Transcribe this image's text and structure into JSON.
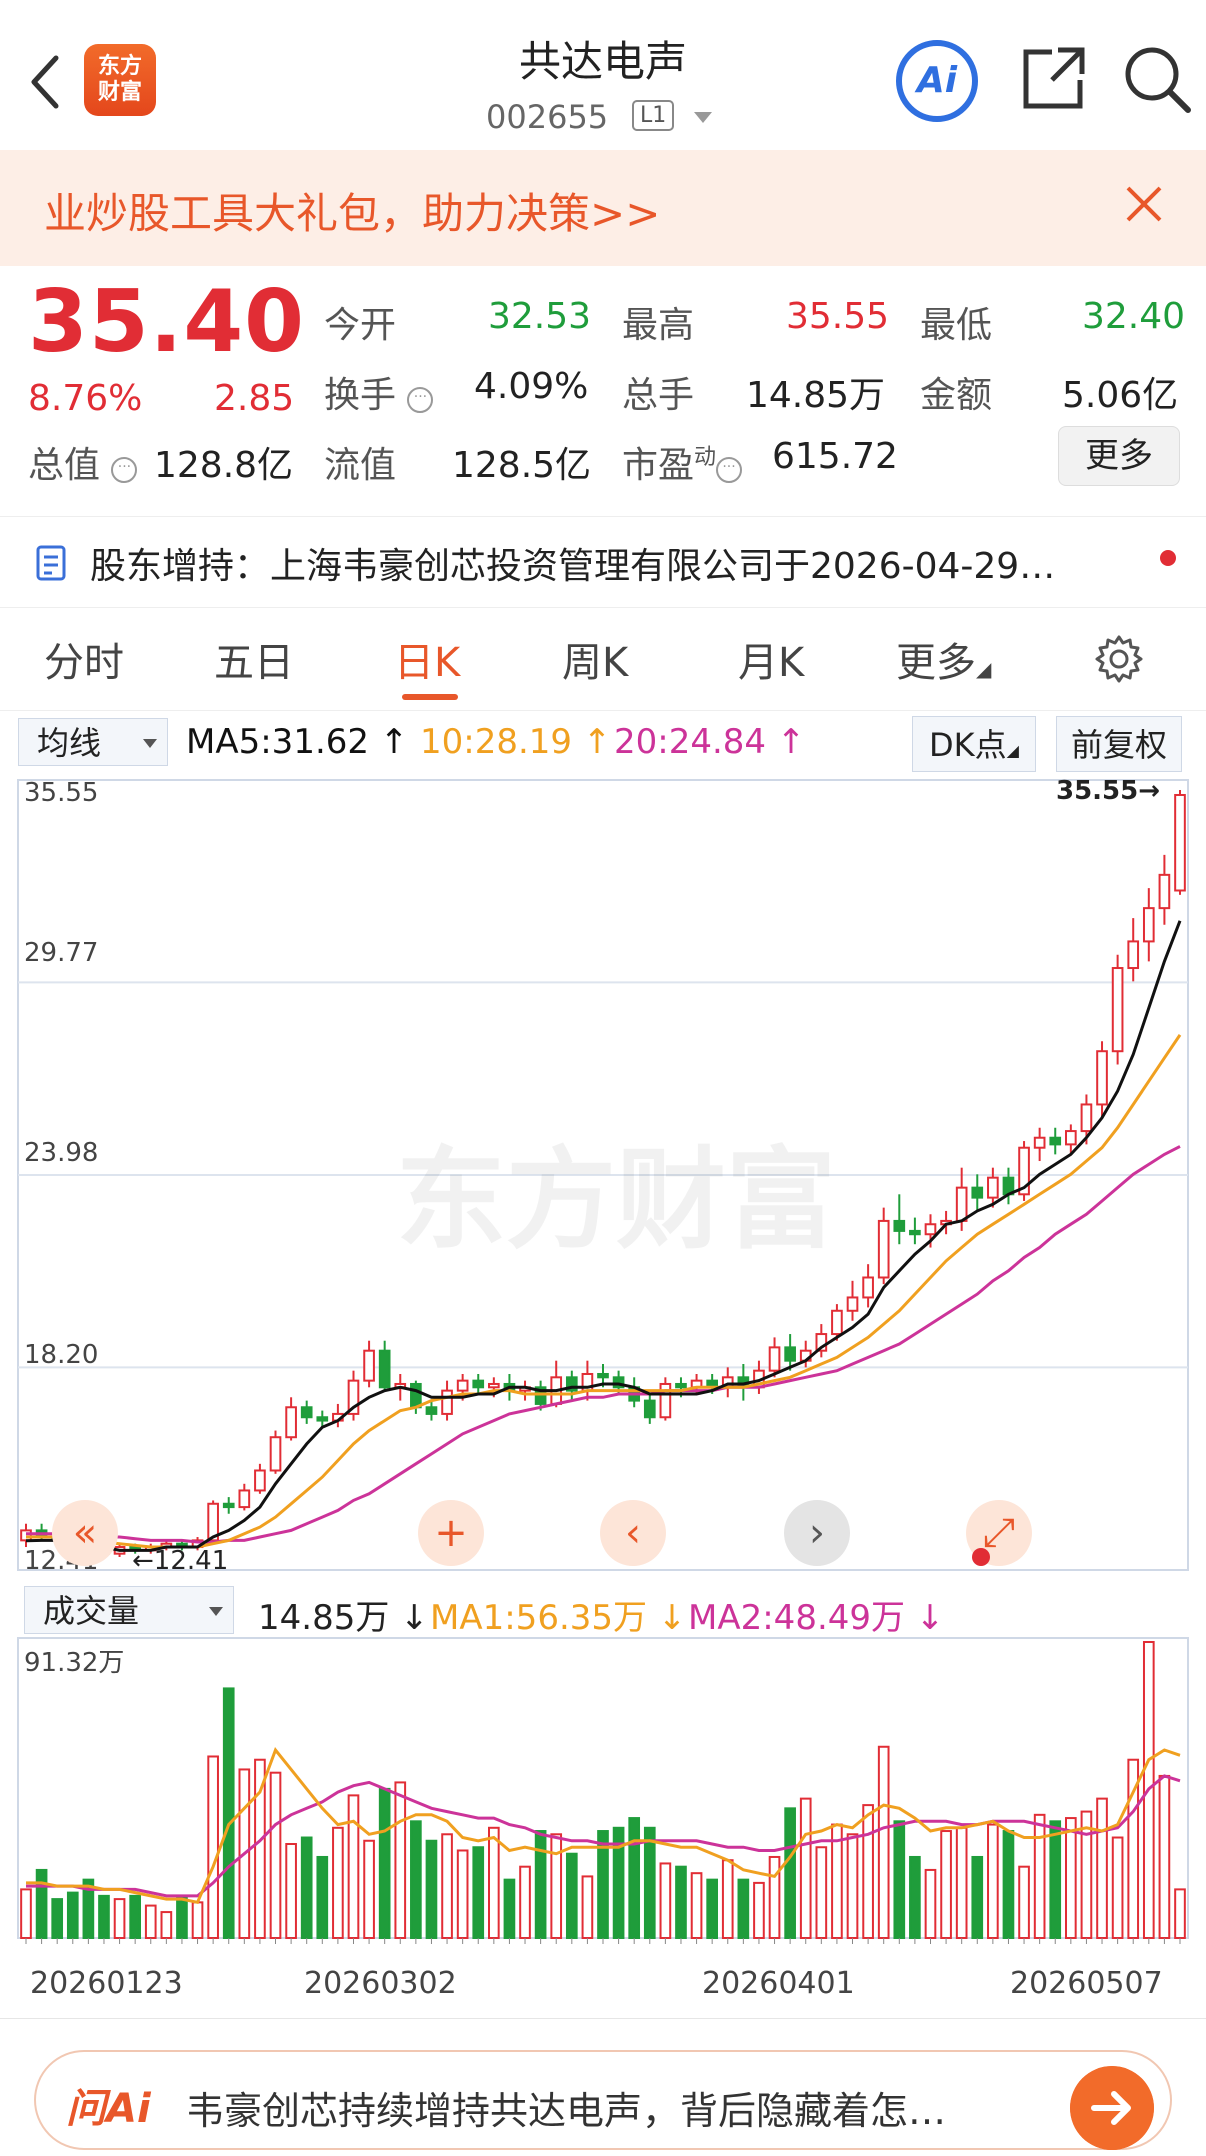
{
  "header": {
    "stock_name": "共达电声",
    "stock_code": "002655",
    "level": "L1",
    "logo_text_1": "东方",
    "logo_text_2": "财富",
    "ai_label": "Ai"
  },
  "banner": {
    "text": "业炒股工具大礼包，助力决策>>"
  },
  "quote": {
    "price": "35.40",
    "change_pct": "8.76%",
    "change": "2.85",
    "open_label": "今开",
    "open": "32.53",
    "high_label": "最高",
    "high": "35.55",
    "low_label": "最低",
    "low": "32.40",
    "turnover_label": "换手",
    "turnover": "4.09%",
    "volume_label": "总手",
    "volume": "14.85万",
    "amount_label": "金额",
    "amount": "5.06亿",
    "mktcap_label": "总值",
    "mktcap": "128.8亿",
    "float_label": "流值",
    "float": "128.5亿",
    "pe_label": "市盈",
    "pe_sup": "动",
    "pe": "615.72",
    "more_label": "更多"
  },
  "notice": {
    "text": "股东增持：上海韦豪创芯投资管理有限公司于2026-04-29…"
  },
  "tabs": [
    {
      "label": "分时"
    },
    {
      "label": "五日"
    },
    {
      "label": "日K"
    },
    {
      "label": "周K"
    },
    {
      "label": "月K"
    },
    {
      "label": "更多"
    }
  ],
  "kline_toolbar": {
    "indicator": "均线",
    "ma5": "MA5:31.62",
    "ma10": "10:28.19",
    "ma20": "20:24.84",
    "dk_label": "DK点",
    "adjust_label": "前复权"
  },
  "colors": {
    "up": "#e12d35",
    "down": "#1f9d3b",
    "ma5": "#111111",
    "ma10": "#f0a020",
    "ma20": "#cc3399",
    "accent": "#e8572a"
  },
  "watermark": "东方财富",
  "volume_toolbar": {
    "indicator": "成交量",
    "vol": "14.85万",
    "ma1": "MA1:56.35万",
    "ma2": "MA2:48.49万",
    "max_label": "91.32万"
  },
  "chart_data": {
    "type": "candlestick",
    "price_axis_labels": [
      "35.55",
      "29.77",
      "23.98",
      "18.20",
      "12.41"
    ],
    "high_marker": "35.55",
    "low_marker": "12.41",
    "ylim": [
      12.41,
      35.55
    ],
    "volume_max": 91.32,
    "date_labels": [
      "20260123",
      "20260302",
      "20260401",
      "20260507"
    ],
    "candles": [
      [
        13.0,
        13.3,
        12.8,
        13.5
      ],
      [
        13.3,
        13.1,
        13.0,
        13.5
      ],
      [
        13.1,
        13.0,
        12.9,
        13.2
      ],
      [
        12.9,
        12.8,
        12.7,
        13.0
      ],
      [
        12.8,
        12.7,
        12.6,
        13.0
      ],
      [
        12.7,
        12.6,
        12.5,
        12.9
      ],
      [
        12.6,
        12.8,
        12.5,
        12.9
      ],
      [
        12.8,
        12.7,
        12.6,
        12.9
      ],
      [
        12.7,
        12.8,
        12.6,
        12.9
      ],
      [
        12.8,
        12.9,
        12.7,
        13.0
      ],
      [
        12.9,
        12.8,
        12.7,
        13.0
      ],
      [
        12.8,
        13.0,
        12.7,
        13.1
      ],
      [
        13.0,
        14.1,
        12.9,
        14.2
      ],
      [
        14.1,
        14.0,
        13.8,
        14.3
      ],
      [
        14.0,
        14.5,
        13.9,
        14.7
      ],
      [
        14.5,
        15.1,
        14.4,
        15.3
      ],
      [
        15.1,
        16.1,
        15.0,
        16.3
      ],
      [
        16.1,
        17.0,
        16.0,
        17.3
      ],
      [
        17.0,
        16.7,
        16.5,
        17.2
      ],
      [
        16.7,
        16.6,
        16.4,
        16.9
      ],
      [
        16.6,
        16.8,
        16.4,
        17.1
      ],
      [
        16.8,
        17.8,
        16.6,
        18.1
      ],
      [
        17.8,
        18.7,
        17.6,
        19.0
      ],
      [
        18.7,
        17.6,
        17.5,
        19.0
      ],
      [
        17.6,
        17.7,
        17.2,
        18.0
      ],
      [
        17.7,
        17.0,
        16.8,
        17.8
      ],
      [
        17.0,
        16.8,
        16.6,
        17.2
      ],
      [
        16.8,
        17.5,
        16.6,
        17.8
      ],
      [
        17.5,
        17.8,
        17.2,
        18.0
      ],
      [
        17.8,
        17.6,
        17.4,
        18.0
      ],
      [
        17.6,
        17.7,
        17.3,
        17.9
      ],
      [
        17.7,
        17.5,
        17.2,
        18.0
      ],
      [
        17.5,
        17.6,
        17.2,
        17.8
      ],
      [
        17.6,
        17.1,
        16.9,
        17.8
      ],
      [
        17.1,
        17.9,
        17.0,
        18.4
      ],
      [
        17.9,
        17.5,
        17.2,
        18.1
      ],
      [
        17.5,
        18.0,
        17.2,
        18.4
      ],
      [
        18.0,
        17.9,
        17.6,
        18.3
      ],
      [
        17.9,
        17.6,
        17.4,
        18.1
      ],
      [
        17.6,
        17.2,
        17.0,
        17.9
      ],
      [
        17.2,
        16.7,
        16.5,
        17.4
      ],
      [
        16.7,
        17.7,
        16.6,
        17.9
      ],
      [
        17.7,
        17.6,
        17.3,
        17.9
      ],
      [
        17.6,
        17.8,
        17.4,
        18.0
      ],
      [
        17.8,
        17.6,
        17.4,
        18.0
      ],
      [
        17.6,
        17.9,
        17.3,
        18.2
      ],
      [
        17.9,
        17.6,
        17.2,
        18.3
      ],
      [
        17.6,
        18.1,
        17.4,
        18.4
      ],
      [
        18.1,
        18.8,
        17.9,
        19.1
      ],
      [
        18.8,
        18.4,
        18.1,
        19.2
      ],
      [
        18.4,
        18.7,
        18.2,
        19.0
      ],
      [
        18.7,
        19.2,
        18.5,
        19.5
      ],
      [
        19.2,
        19.9,
        19.0,
        20.1
      ],
      [
        19.9,
        20.3,
        19.6,
        20.8
      ],
      [
        20.3,
        20.9,
        20.0,
        21.3
      ],
      [
        20.9,
        22.6,
        20.7,
        23.0
      ],
      [
        22.6,
        22.3,
        21.9,
        23.4
      ],
      [
        22.3,
        22.2,
        21.9,
        22.7
      ],
      [
        22.2,
        22.5,
        21.8,
        22.8
      ],
      [
        22.5,
        22.6,
        22.2,
        22.9
      ],
      [
        22.6,
        23.6,
        22.3,
        24.2
      ],
      [
        23.6,
        23.3,
        22.9,
        24.0
      ],
      [
        23.3,
        23.9,
        23.0,
        24.2
      ],
      [
        23.9,
        23.4,
        23.1,
        24.2
      ],
      [
        23.4,
        24.8,
        23.2,
        25.0
      ],
      [
        24.8,
        25.1,
        24.4,
        25.4
      ],
      [
        25.1,
        24.9,
        24.6,
        25.4
      ],
      [
        24.9,
        25.3,
        24.6,
        25.5
      ],
      [
        25.3,
        26.1,
        24.9,
        26.4
      ],
      [
        26.1,
        27.7,
        25.7,
        28.0
      ],
      [
        27.7,
        30.2,
        27.3,
        30.6
      ],
      [
        30.2,
        31.0,
        29.8,
        31.7
      ],
      [
        31.0,
        32.0,
        30.4,
        32.6
      ],
      [
        32.0,
        33.0,
        31.5,
        33.6
      ],
      [
        32.53,
        35.4,
        32.4,
        35.55
      ]
    ],
    "ma5": [
      12.99,
      13.0,
      13.0,
      13.0,
      12.9,
      12.8,
      12.7,
      12.7,
      12.7,
      12.8,
      12.8,
      12.8,
      13.1,
      13.3,
      13.6,
      14.0,
      14.7,
      15.3,
      15.9,
      16.4,
      16.6,
      17.0,
      17.3,
      17.5,
      17.6,
      17.5,
      17.3,
      17.3,
      17.3,
      17.4,
      17.4,
      17.6,
      17.6,
      17.5,
      17.5,
      17.6,
      17.6,
      17.7,
      17.7,
      17.6,
      17.4,
      17.4,
      17.4,
      17.4,
      17.5,
      17.7,
      17.7,
      17.8,
      18.0,
      18.2,
      18.4,
      18.8,
      19.1,
      19.4,
      19.8,
      20.6,
      21.1,
      21.6,
      22.0,
      22.5,
      22.6,
      22.9,
      23.1,
      23.4,
      23.6,
      24.0,
      24.3,
      24.6,
      25.1,
      25.7,
      26.5,
      27.6,
      29.0,
      30.4,
      31.62
    ],
    "ma10": [
      13.1,
      13.1,
      13.1,
      13.05,
      13.0,
      12.95,
      12.9,
      12.85,
      12.8,
      12.8,
      12.8,
      12.8,
      12.9,
      13.0,
      13.2,
      13.4,
      13.7,
      14.1,
      14.5,
      14.9,
      15.4,
      15.9,
      16.3,
      16.6,
      16.9,
      17.0,
      17.2,
      17.3,
      17.4,
      17.4,
      17.5,
      17.5,
      17.4,
      17.4,
      17.4,
      17.4,
      17.5,
      17.5,
      17.5,
      17.5,
      17.5,
      17.5,
      17.5,
      17.6,
      17.6,
      17.6,
      17.6,
      17.7,
      17.8,
      17.9,
      18.1,
      18.3,
      18.5,
      18.8,
      19.1,
      19.5,
      19.9,
      20.4,
      20.9,
      21.4,
      21.8,
      22.2,
      22.5,
      22.8,
      23.1,
      23.4,
      23.7,
      24.0,
      24.4,
      24.8,
      25.4,
      26.1,
      26.8,
      27.5,
      28.19
    ],
    "ma20": [
      13.2,
      13.2,
      13.2,
      13.2,
      13.15,
      13.1,
      13.1,
      13.05,
      13.0,
      13.0,
      13.0,
      12.95,
      12.95,
      13.0,
      13.0,
      13.1,
      13.2,
      13.3,
      13.5,
      13.7,
      13.9,
      14.2,
      14.4,
      14.7,
      15.0,
      15.3,
      15.6,
      15.9,
      16.2,
      16.4,
      16.6,
      16.8,
      16.9,
      17.0,
      17.1,
      17.2,
      17.3,
      17.3,
      17.4,
      17.4,
      17.4,
      17.5,
      17.5,
      17.5,
      17.5,
      17.6,
      17.6,
      17.6,
      17.7,
      17.8,
      17.9,
      18.0,
      18.1,
      18.3,
      18.5,
      18.7,
      18.9,
      19.2,
      19.5,
      19.8,
      20.1,
      20.4,
      20.8,
      21.1,
      21.5,
      21.8,
      22.2,
      22.5,
      22.8,
      23.2,
      23.6,
      24.0,
      24.3,
      24.6,
      24.84
    ],
    "volumes": [
      15,
      21,
      12,
      14,
      18,
      13,
      12,
      13,
      10,
      8,
      13,
      11,
      56,
      77,
      52,
      55,
      51,
      29,
      31,
      25,
      34,
      44,
      30,
      46,
      48,
      36,
      30,
      32,
      27,
      28,
      34,
      18,
      22,
      33,
      32,
      26,
      19,
      33,
      34,
      37,
      34,
      23,
      22,
      20,
      18,
      24,
      18,
      17,
      25,
      40,
      43,
      28,
      35,
      32,
      41,
      59,
      36,
      25,
      21,
      33,
      34,
      25,
      35,
      33,
      22,
      38,
      36,
      37,
      39,
      43,
      31,
      55,
      91.32,
      50,
      15
    ],
    "vol_ma1": [
      17,
      17,
      16,
      16,
      16,
      15,
      15,
      14,
      13,
      12,
      12,
      11,
      22,
      35,
      40,
      45,
      58,
      52,
      46,
      40,
      35,
      36,
      32,
      33,
      36,
      38,
      38,
      36,
      31,
      30,
      31,
      27,
      28,
      27,
      26,
      28,
      28,
      28,
      28,
      30,
      30,
      29,
      28,
      28,
      26,
      24,
      21,
      20,
      19,
      25,
      32,
      33,
      35,
      34,
      38,
      41,
      40,
      37,
      33,
      34,
      34,
      35,
      36,
      33,
      31,
      31,
      32,
      33,
      34,
      33,
      35,
      45,
      55,
      58,
      56.35
    ],
    "vol_ma2": [
      16,
      16,
      16,
      16,
      15,
      15,
      15,
      15,
      14,
      13,
      13,
      13,
      17,
      22,
      26,
      30,
      35,
      38,
      40,
      42,
      45,
      47,
      48,
      46,
      44,
      42,
      40,
      39,
      38,
      37,
      37,
      35,
      34,
      32,
      31,
      30,
      30,
      29,
      29,
      29,
      30,
      30,
      30,
      30,
      29,
      28,
      28,
      27,
      27,
      28,
      29,
      30,
      30,
      31,
      32,
      34,
      35,
      36,
      36,
      36,
      35,
      35,
      36,
      36,
      36,
      35,
      34,
      33,
      32,
      33,
      34,
      39,
      46,
      50,
      48.49
    ]
  },
  "chart_controls": [
    "«",
    "+",
    "‹",
    "›",
    "⤢"
  ],
  "bottom_ask": {
    "brand": "问Ai",
    "text": "韦豪创芯持续增持共达电声，背后隐藏着怎…"
  }
}
